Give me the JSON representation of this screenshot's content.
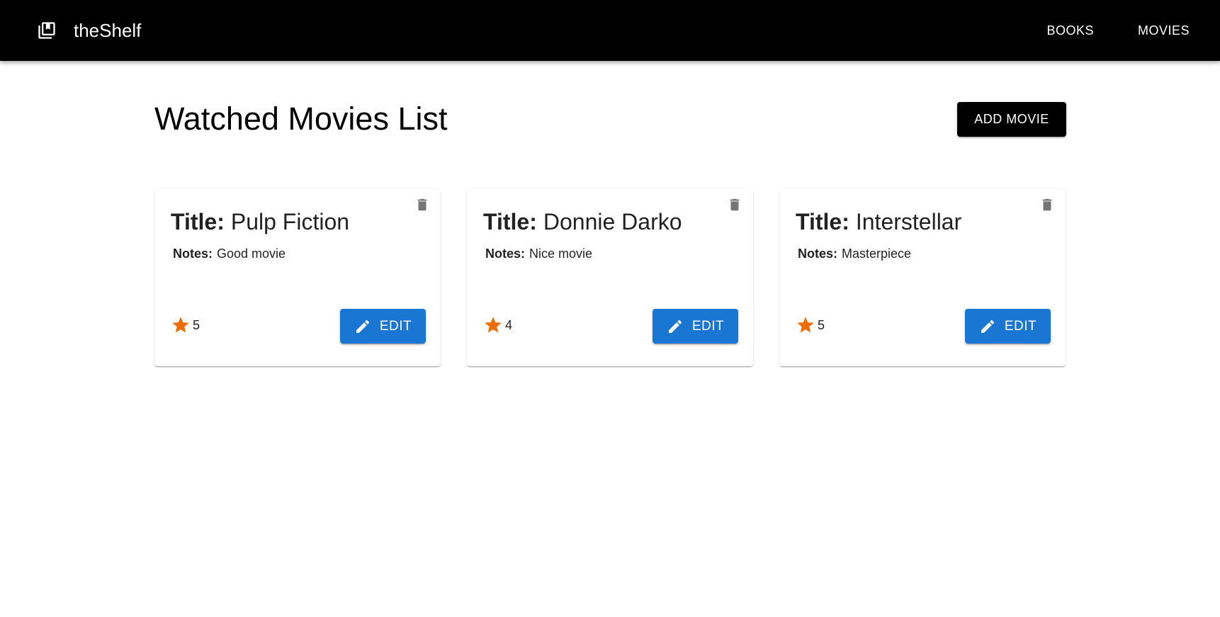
{
  "app": {
    "brand": "theShelf",
    "brand_icon": "library-books-icon"
  },
  "nav": {
    "items": [
      {
        "label": "BOOKS"
      },
      {
        "label": "MOVIES"
      }
    ]
  },
  "page": {
    "title": "Watched Movies List",
    "add_button_label": "ADD MOVIE"
  },
  "labels": {
    "title": "Title:",
    "notes": "Notes:",
    "edit": "EDIT"
  },
  "movies": [
    {
      "title": "Pulp Fiction",
      "notes": "Good movie",
      "rating": "5"
    },
    {
      "title": "Donnie Darko",
      "notes": "Nice movie",
      "rating": "4"
    },
    {
      "title": "Interstellar",
      "notes": "Masterpiece",
      "rating": "5"
    }
  ],
  "colors": {
    "appbar": "#000000",
    "add_button": "#000000",
    "edit_button": "#1976d2",
    "star": "#ed6c02",
    "delete_icon": "#757575"
  },
  "icons": {
    "delete": "delete-icon",
    "edit": "pencil-icon",
    "rating": "star-icon"
  }
}
